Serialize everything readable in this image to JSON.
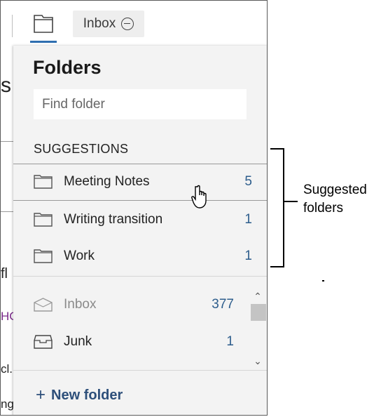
{
  "topbar": {
    "inbox_label": "Inbox"
  },
  "background_fragments": {
    "s": "s",
    "fl": "fl",
    "ho": "HO",
    "cl": "cl.",
    "ng": "ng"
  },
  "panel": {
    "title": "Folders",
    "find_placeholder": "Find folder",
    "suggestions_header": "SUGGESTIONS",
    "suggestions": [
      {
        "label": "Meeting Notes",
        "count": "5"
      },
      {
        "label": "Writing transition",
        "count": "1"
      },
      {
        "label": "Work",
        "count": "1"
      }
    ],
    "folders": [
      {
        "label": "Inbox",
        "count": "377",
        "icon": "inbox-icon"
      },
      {
        "label": "Junk",
        "count": "1",
        "icon": "junk-icon"
      }
    ],
    "new_folder_label": "New folder"
  },
  "annotation": {
    "line1": "Suggested",
    "line2": "folders"
  },
  "colors": {
    "accent": "#2f6fb0",
    "count": "#2d5d8c",
    "new_folder": "#2d4f7a",
    "panel_bg": "#f3f3f3"
  }
}
